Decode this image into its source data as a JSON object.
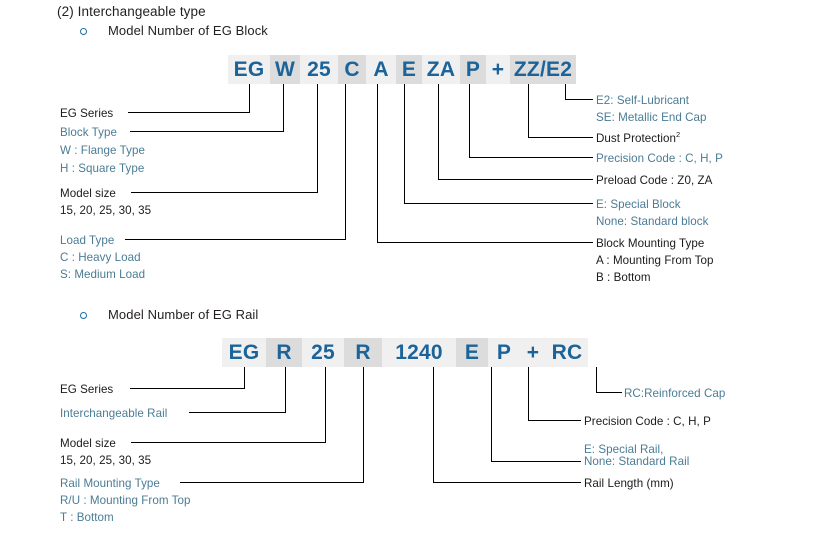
{
  "page": {
    "section_heading": "(2) Interchangeable type"
  },
  "block_section": {
    "title": "Model Number of EG Block",
    "code_segments": [
      {
        "text": "EG"
      },
      {
        "text": "W"
      },
      {
        "text": "25"
      },
      {
        "text": "C"
      },
      {
        "text": "A"
      },
      {
        "text": "E"
      },
      {
        "text": "ZA"
      },
      {
        "text": "P"
      },
      {
        "text": "+"
      },
      {
        "text": "ZZ/E2"
      }
    ],
    "left_labels": [
      {
        "lines": [
          {
            "text": "EG Series",
            "color": "dark"
          }
        ]
      },
      {
        "lines": [
          {
            "text": "Block Type",
            "color": "blue"
          },
          {
            "text": "W : Flange Type",
            "color": "blue"
          },
          {
            "text": "H : Square Type",
            "color": "blue"
          }
        ]
      },
      {
        "lines": [
          {
            "text": "Model size",
            "color": "dark"
          },
          {
            "text": "15, 20, 25, 30, 35",
            "color": "dark"
          }
        ]
      },
      {
        "lines": [
          {
            "text": "Load Type",
            "color": "blue"
          },
          {
            "text": "C : Heavy Load",
            "color": "blue"
          },
          {
            "text": "S: Medium Load",
            "color": "blue"
          }
        ]
      }
    ],
    "right_labels": [
      {
        "lines": [
          {
            "text": "E2: Self-Lubricant",
            "color": "blue"
          },
          {
            "text": "SE: Metallic End Cap",
            "color": "blue"
          }
        ]
      },
      {
        "lines": [
          {
            "text": "Dust Protection",
            "sup": "2",
            "color": "dark"
          }
        ]
      },
      {
        "lines": [
          {
            "text": "Precision Code : C, H, P",
            "color": "blue"
          }
        ]
      },
      {
        "lines": [
          {
            "text": "Preload Code : Z0, ZA",
            "color": "dark"
          }
        ]
      },
      {
        "lines": [
          {
            "text": "E: Special Block",
            "color": "blue"
          },
          {
            "text": "None: Standard block",
            "color": "blue"
          }
        ]
      },
      {
        "lines": [
          {
            "text": "Block Mounting Type",
            "color": "dark"
          },
          {
            "text": "A : Mounting From Top",
            "color": "dark"
          },
          {
            "text": "B : Bottom",
            "color": "dark"
          }
        ]
      }
    ]
  },
  "rail_section": {
    "title": "Model Number of EG Rail",
    "code_segments": [
      {
        "text": "EG"
      },
      {
        "text": "R"
      },
      {
        "text": "25"
      },
      {
        "text": "R"
      },
      {
        "text": "1240"
      },
      {
        "text": "E"
      },
      {
        "text": "P"
      },
      {
        "text": "+"
      },
      {
        "text": "RC"
      }
    ],
    "left_labels": [
      {
        "lines": [
          {
            "text": "EG Series",
            "color": "dark"
          }
        ]
      },
      {
        "lines": [
          {
            "text": "Interchangeable Rail",
            "color": "blue"
          }
        ]
      },
      {
        "lines": [
          {
            "text": "Model size",
            "color": "dark"
          },
          {
            "text": "15, 20, 25, 30, 35",
            "color": "dark"
          }
        ]
      },
      {
        "lines": [
          {
            "text": "Rail Mounting Type",
            "color": "blue"
          },
          {
            "text": "R/U : Mounting From Top",
            "color": "blue"
          },
          {
            "text": "T : Bottom",
            "color": "blue"
          }
        ]
      }
    ],
    "right_labels": [
      {
        "lines": [
          {
            "text": "RC:Reinforced Cap",
            "color": "blue"
          }
        ]
      },
      {
        "lines": [
          {
            "text": "Precision Code : C, H, P",
            "color": "dark"
          }
        ]
      },
      {
        "lines": [
          {
            "text": "E: Special Rail,",
            "color": "blue"
          },
          {
            "text": "None: Standard Rail",
            "color": "blue"
          }
        ]
      },
      {
        "lines": [
          {
            "text": "Rail Length (mm)",
            "color": "dark"
          }
        ]
      }
    ]
  },
  "colors": {
    "code_text": "#1b6398",
    "blue_label": "#4a7c95",
    "dark_label": "#1b1b1b",
    "bullet": "#1e6ca6",
    "seg_bg_light": "#f0f0f0",
    "seg_bg_dark": "#dcdcdc"
  }
}
